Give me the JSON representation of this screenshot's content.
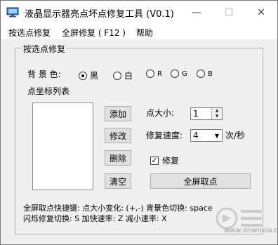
{
  "window": {
    "title": "液晶显示器亮点坏点修复工具 (V0.1)",
    "minimize": "—",
    "maximize": "☐",
    "close": "✕"
  },
  "menu": [
    "按选点修复",
    "全屏修复 ( F12 )",
    "帮助"
  ],
  "group": {
    "title": "按选点修复",
    "bg_label": "背 景 色:",
    "radios": [
      {
        "label": "黑",
        "checked": true
      },
      {
        "label": "白",
        "checked": false
      },
      {
        "label": "R",
        "checked": false
      },
      {
        "label": "G",
        "checked": false
      },
      {
        "label": "B",
        "checked": false
      }
    ],
    "list_label": "点坐标列表",
    "buttons": {
      "add": "添加",
      "modify": "修改",
      "delete": "删除",
      "clear": "清空",
      "fullscreen": "全屏取点"
    },
    "point_size_label": "点大小:",
    "point_size_value": "1",
    "speed_label": "修复速度:",
    "speed_value": "4",
    "speed_unit": "次/秒",
    "repair_checkbox": {
      "label": "修复",
      "checked": true
    }
  },
  "shortcuts": {
    "line1": "全屏取点快捷键: 点大小变化: (+,-)  背景色切换: space",
    "line2": "闪烁修复切换: S  加快速率: Z  减小速率: X"
  },
  "watermark": {
    "text": "www.downxia.com"
  }
}
